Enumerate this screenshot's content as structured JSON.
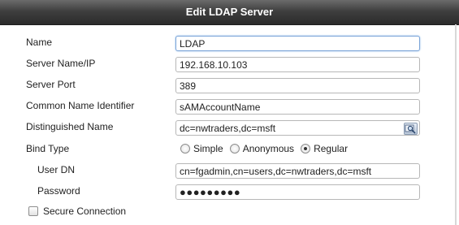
{
  "dialog": {
    "title": "Edit LDAP Server"
  },
  "fields": {
    "name": {
      "label": "Name",
      "value": "LDAP"
    },
    "server": {
      "label": "Server Name/IP",
      "value": "192.168.10.103"
    },
    "port": {
      "label": "Server Port",
      "value": "389"
    },
    "cn_identifier": {
      "label": "Common Name Identifier",
      "value": "sAMAccountName"
    },
    "dn": {
      "label": "Distinguished Name",
      "value": "dc=nwtraders,dc=msft",
      "browse_icon": "search-browse-icon"
    },
    "bind_type": {
      "label": "Bind Type",
      "options": [
        "Simple",
        "Anonymous",
        "Regular"
      ],
      "selected": "Regular"
    },
    "user_dn": {
      "label": "User DN",
      "value": "cn=fgadmin,cn=users,dc=nwtraders,dc=msft"
    },
    "password": {
      "label": "Password",
      "value": "●●●●●●●●●"
    },
    "secure": {
      "label": "Secure Connection",
      "checked": false
    }
  }
}
